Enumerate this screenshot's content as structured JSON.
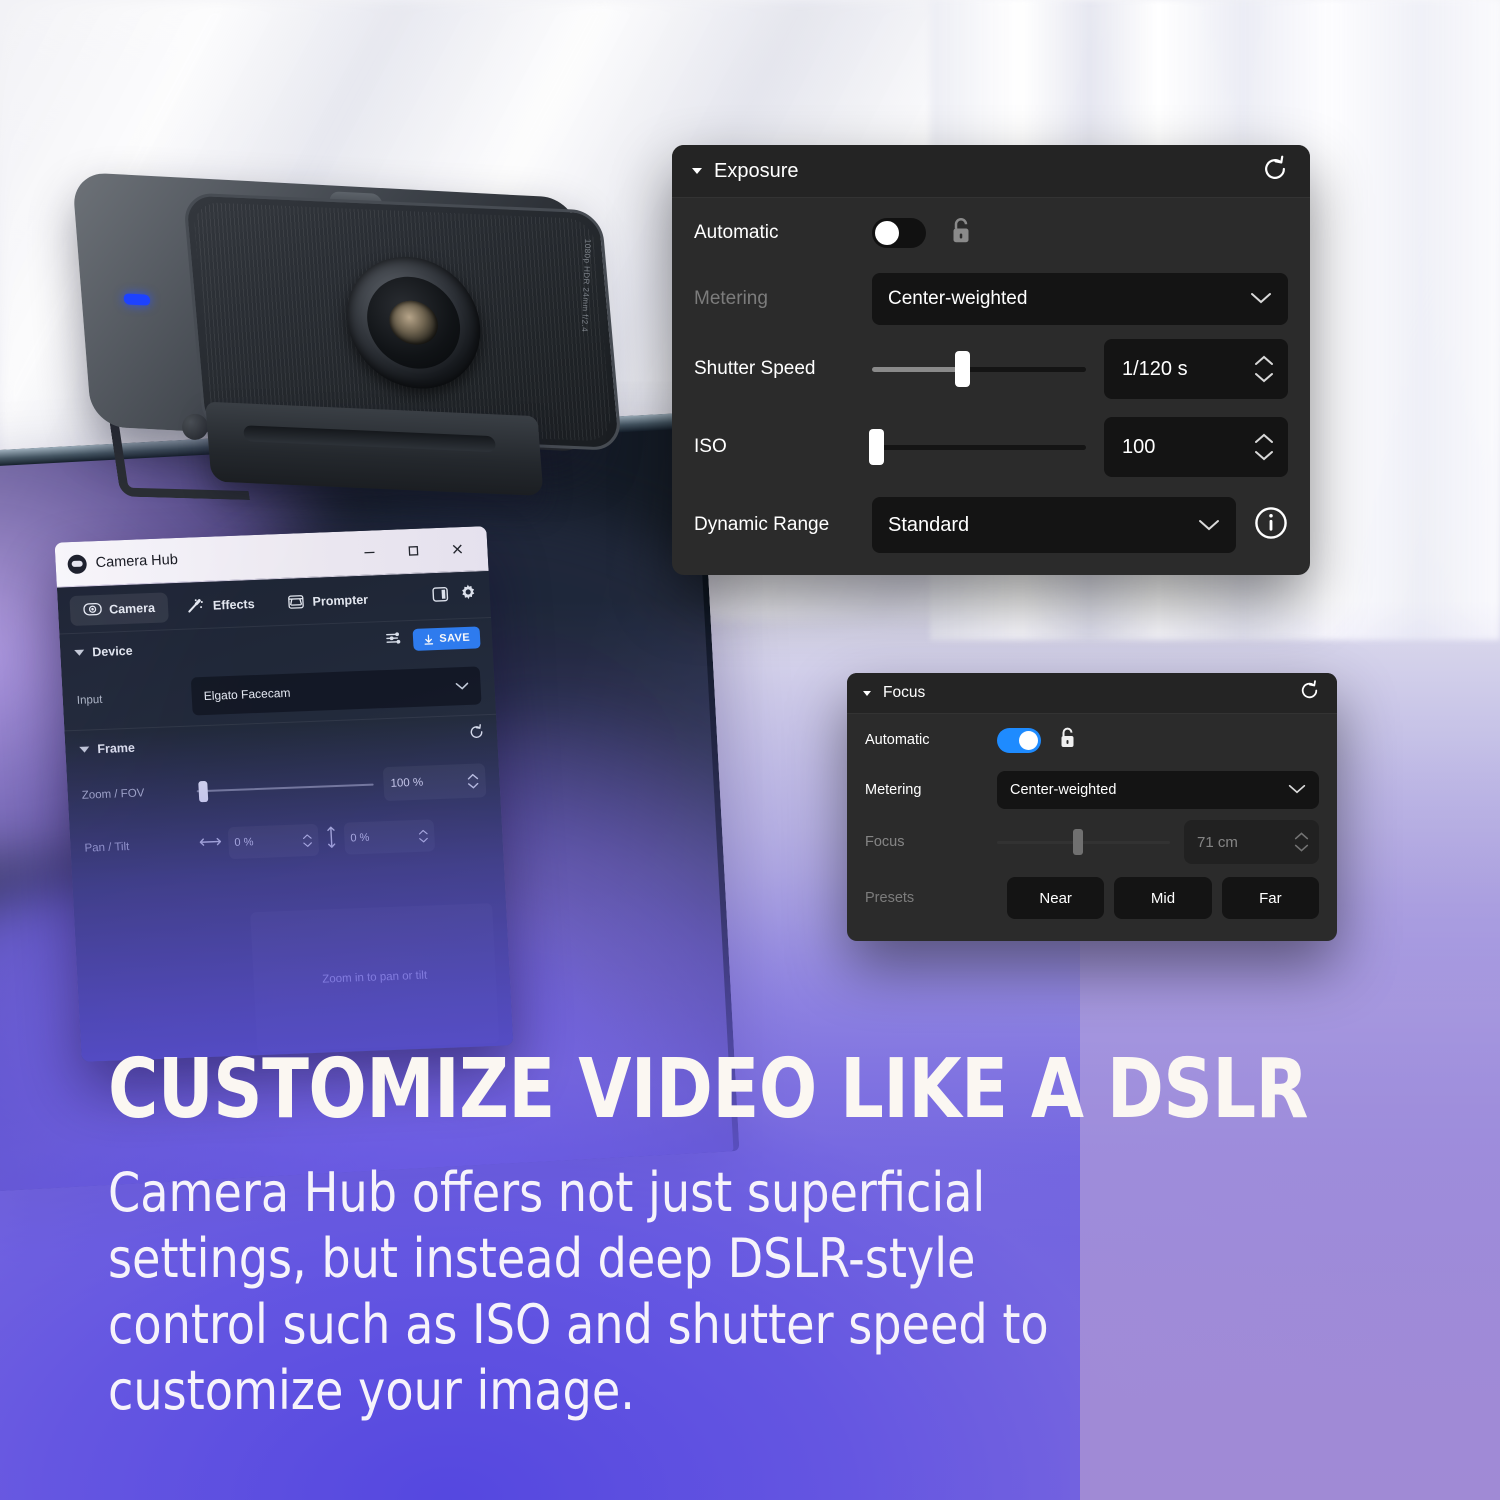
{
  "marketing": {
    "headline": "CUSTOMIZE VIDEO LIKE A DSLR",
    "body": "Camera Hub offers not just superficial settings, but instead deep DSLR-style control such as ISO and shutter speed to customize your image."
  },
  "webcam": {
    "lens_label": "1080p HDR 24mm f/2.4"
  },
  "camera_hub": {
    "window_title": "Camera Hub",
    "window_controls": {
      "minimize": "minimize",
      "maximize": "maximize",
      "close": "close"
    },
    "tabs": [
      {
        "label": "Camera",
        "icon": "camera-icon",
        "active": true
      },
      {
        "label": "Effects",
        "icon": "magic-wand-icon",
        "active": false
      },
      {
        "label": "Prompter",
        "icon": "prompter-icon",
        "active": false
      }
    ],
    "toolbar_icons": [
      {
        "name": "panel-toggle-icon"
      },
      {
        "name": "gear-icon"
      }
    ],
    "device_section": {
      "title": "Device",
      "sliders_icon": "sliders-icon",
      "save_label": "SAVE",
      "input_label": "Input",
      "input_value": "Elgato Facecam"
    },
    "frame_section": {
      "title": "Frame",
      "reset_icon": "reset-icon",
      "zoom_label": "Zoom / FOV",
      "zoom_value": "100 %",
      "zoom_percent": 3,
      "pantilt_label": "Pan / Tilt",
      "pan_value": "0 %",
      "tilt_value": "0 %",
      "preview_note": "Zoom in to pan or tilt"
    }
  },
  "exposure_panel": {
    "title": "Exposure",
    "reset_icon": "reset-icon",
    "automatic_label": "Automatic",
    "automatic_on": false,
    "lock_icon": "unlocked-padlock-icon",
    "metering_label": "Metering",
    "metering_value": "Center-weighted",
    "metering_disabled": true,
    "shutter_label": "Shutter Speed",
    "shutter_value": "1/120 s",
    "shutter_percent": 42,
    "iso_label": "ISO",
    "iso_value": "100",
    "iso_percent": 2,
    "dynamic_range_label": "Dynamic Range",
    "dynamic_range_value": "Standard",
    "info_icon": "info-icon"
  },
  "focus_panel": {
    "title": "Focus",
    "reset_icon": "reset-icon",
    "automatic_label": "Automatic",
    "automatic_on": true,
    "lock_icon": "unlocked-padlock-icon",
    "metering_label": "Metering",
    "metering_value": "Center-weighted",
    "focus_label": "Focus",
    "focus_value": "71 cm",
    "focus_percent": 48,
    "presets_label": "Presets",
    "presets": [
      "Near",
      "Mid",
      "Far"
    ]
  },
  "colors": {
    "accent_blue": "#1e8bff",
    "save_blue": "#2f7ef4",
    "panel_bg": "#2b2b2b",
    "panel_head_bg": "#242424",
    "field_bg": "#141414",
    "led_blue": "#1d42ff"
  }
}
